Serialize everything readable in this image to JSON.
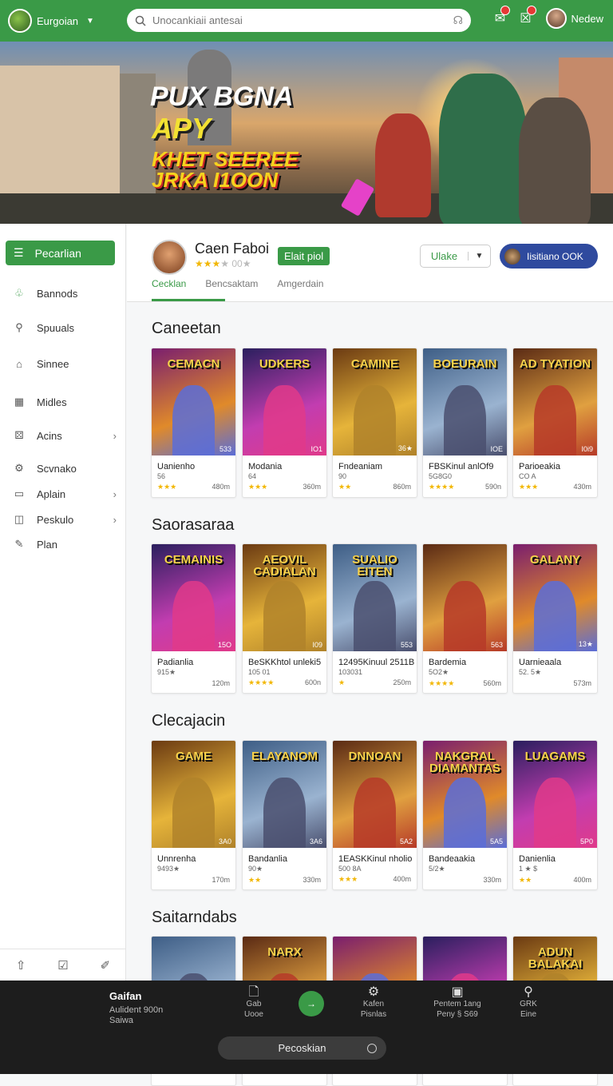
{
  "topbar": {
    "brand": "Eurgoian",
    "search_placeholder": "Unocankiaii antesai",
    "user_name": "Nedew"
  },
  "hero": {
    "line1": "PUX BGNA",
    "line2": "APY",
    "line3": "KHET SEEREE",
    "line4": "JRKA I1OON"
  },
  "sidebar": {
    "primary": "Pecarlian",
    "items": [
      {
        "label": "Bannods",
        "icon": "leaf-icon"
      },
      {
        "label": "Spuuals",
        "icon": "search-icon"
      },
      {
        "label": "Sinnee",
        "icon": "home-icon"
      },
      {
        "label": "Midles",
        "icon": "grid-icon"
      },
      {
        "label": "Acins",
        "icon": "dice-icon"
      },
      {
        "label": "Scvnako",
        "icon": "gear-icon"
      },
      {
        "label": "Aplain",
        "icon": "window-icon"
      },
      {
        "label": "Peskulo",
        "icon": "controller-icon"
      },
      {
        "label": "Plan",
        "icon": "edit-icon"
      }
    ]
  },
  "profile": {
    "name": "Caen Faboi",
    "rating_count": "00★",
    "badge": "Elait piol",
    "tabs": [
      "Cecklan",
      "Bencsaktam",
      "Amgerdain"
    ],
    "select_value": "Ulake",
    "button_label": "Iisitiano OOK"
  },
  "sections": [
    {
      "title": "Caneetan",
      "cards": [
        {
          "art": "CEMACN",
          "size": "533",
          "name": "Uanienho",
          "sub": "56",
          "stars": "★★★",
          "dl": "480m"
        },
        {
          "art": "UDKERS",
          "size": "IO1",
          "name": "Modania",
          "sub": "64",
          "stars": "★★★",
          "dl": "360m"
        },
        {
          "art": "CAMINE",
          "size": "36★",
          "name": "Fndeaniam",
          "sub": "90",
          "stars": "★★",
          "dl": "860m"
        },
        {
          "art": "BOEURAIN",
          "size": "IOE",
          "name": "FBSKinul anlOf9",
          "sub": "5G8G0",
          "stars": "★★★★",
          "dl": "590n"
        },
        {
          "art": "AD TYATION",
          "size": "I0i9",
          "name": "Parioeakia",
          "sub": "CO A",
          "stars": "★★★",
          "dl": "430m"
        }
      ]
    },
    {
      "title": "Saorasaraa",
      "cards": [
        {
          "art": "CEMAINIS",
          "size": "15O",
          "name": "Padianlia",
          "sub": "915★",
          "stars": "",
          "dl": "120m"
        },
        {
          "art": "AEOVIL CADIALAN",
          "size": "I09",
          "name": "BeSKKhtol unleki5",
          "sub": "105 01",
          "stars": "★★★★",
          "dl": "600n"
        },
        {
          "art": "SUALIO EITEN",
          "size": "553",
          "name": "12495Kinuul 2511B",
          "sub": "103031",
          "stars": "★",
          "dl": "250m"
        },
        {
          "art": "",
          "size": "563",
          "name": "Bardemia",
          "sub": "5O2★",
          "stars": "★★★★",
          "dl": "560m"
        },
        {
          "art": "GALANY",
          "size": "13★",
          "name": "Uarnieaala",
          "sub": "52. 5★",
          "stars": "",
          "dl": "573m"
        }
      ]
    },
    {
      "title": "Clecajacin",
      "cards": [
        {
          "art": "GAME",
          "size": "3A0",
          "name": "Unnrenha",
          "sub": "9493★",
          "stars": "",
          "dl": "170m"
        },
        {
          "art": "ELAYANOM",
          "size": "3A6",
          "name": "Bandanlia",
          "sub": "90★",
          "stars": "★★",
          "dl": "330m"
        },
        {
          "art": "DNNOAN",
          "size": "5A2",
          "name": "1EASKKinul nholio",
          "sub": "500 8A",
          "stars": "★★★",
          "dl": "400m"
        },
        {
          "art": "NAKGRAL DIAMANTAS",
          "size": "5A5",
          "name": "Bandeaakia",
          "sub": "5/2★",
          "stars": "",
          "dl": "330m"
        },
        {
          "art": "LUAGAMS",
          "size": "5P0",
          "name": "Danienlia",
          "sub": "1 ★ $",
          "stars": "★★",
          "dl": "400m"
        }
      ]
    },
    {
      "title": "Saitarndabs",
      "cards": [
        {
          "art": ""
        },
        {
          "art": "NARX"
        },
        {
          "art": ""
        },
        {
          "art": ""
        },
        {
          "art": "ADUN BALAKAI"
        }
      ]
    }
  ],
  "player": {
    "title": "Gaifan",
    "sub1": "Aulident 900n",
    "sub2": "Saiwa",
    "controls": [
      {
        "l1": "Gab",
        "l2": "Uooe",
        "icon": "file-icon"
      },
      {
        "l1": "Kafen",
        "l2": "Pisnlas",
        "icon": "settings-icon"
      },
      {
        "l1": "Pentem 1ang",
        "l2": "Peny § S69",
        "icon": "image-icon"
      },
      {
        "l1": "GRK",
        "l2": "Eine",
        "icon": "search-icon"
      }
    ],
    "bar_label": "Pecoskian"
  }
}
